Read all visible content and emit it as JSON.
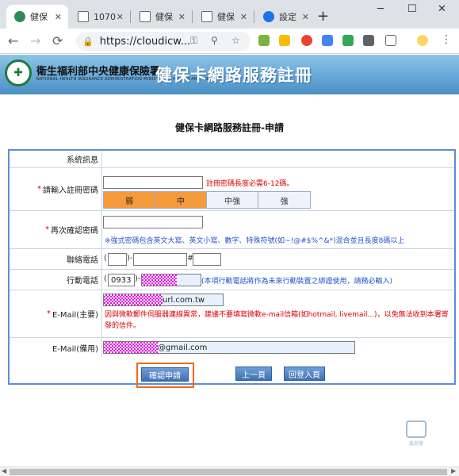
{
  "browser": {
    "tabs": [
      {
        "label": "健保"
      },
      {
        "label": "1070"
      },
      {
        "label": "健保"
      },
      {
        "label": "健保"
      },
      {
        "label": "設定"
      }
    ],
    "new_tab": "+",
    "url": "https://cloudicw...",
    "window": {
      "minimize": "─",
      "maximize": "☐",
      "close": "✕"
    },
    "nav": {
      "back": "←",
      "forward": "→",
      "reload": "⟳"
    }
  },
  "banner": {
    "org_name": "衛生福利部中央健康保險署",
    "org_sub": "NATIONAL HEALTH INSURANCE ADMINISTRATION MINISTRY OF HEALTH AND WELFARE",
    "title": "健保卡網路服務註冊"
  },
  "page": {
    "heading": "健保卡網路服務註冊-申請"
  },
  "form": {
    "system_msg_label": "系統訊息",
    "password_label": "請輸入註冊密碼",
    "password_hint": "註冊密碼長度必需6-12碼。",
    "strength": [
      {
        "label": "弱",
        "active": true
      },
      {
        "label": "中",
        "active": true
      },
      {
        "label": "中強",
        "active": false
      },
      {
        "label": "強",
        "active": false
      }
    ],
    "confirm_label": "再次確認密碼",
    "confirm_hint": "※強式密碼包含英文大寫、英文小寫、數字、特殊符號(如~!@#$%^&*)混合並且長度8碼以上",
    "phone_label": "聯絡電話",
    "phone_open": "(",
    "phone_close": ")-",
    "phone_hash": "#",
    "mobile_label": "行動電話",
    "mobile_open": "(",
    "mobile_prefix": "0933",
    "mobile_close": ")-",
    "mobile_hint": "(本項行動電話將作為未來行動裝置之綁證使用，請務必輸入)",
    "email_main_label": "E-Mail(主要)",
    "email_main_value": "url.com.tw",
    "email_main_hint": "因與微軟郵件伺服器連線異常，建議不要填寫微軟e-mail信箱(如hotmail, livemail...)，以免無法收到本署寄發的信件。",
    "email_backup_label": "E-Mail(備用)",
    "email_backup_value": "@gmail.com",
    "required_mark": "*"
  },
  "buttons": {
    "submit": "確認申請",
    "prev": "上一頁",
    "back_login": "回登入頁"
  },
  "watermark": {
    "text": "鑫部落"
  },
  "colors": {
    "accent_orange": "#f59a3a",
    "frame_blue": "#5b8fd6",
    "required_red": "#dd0000",
    "hint_blue": "#2255cc"
  }
}
